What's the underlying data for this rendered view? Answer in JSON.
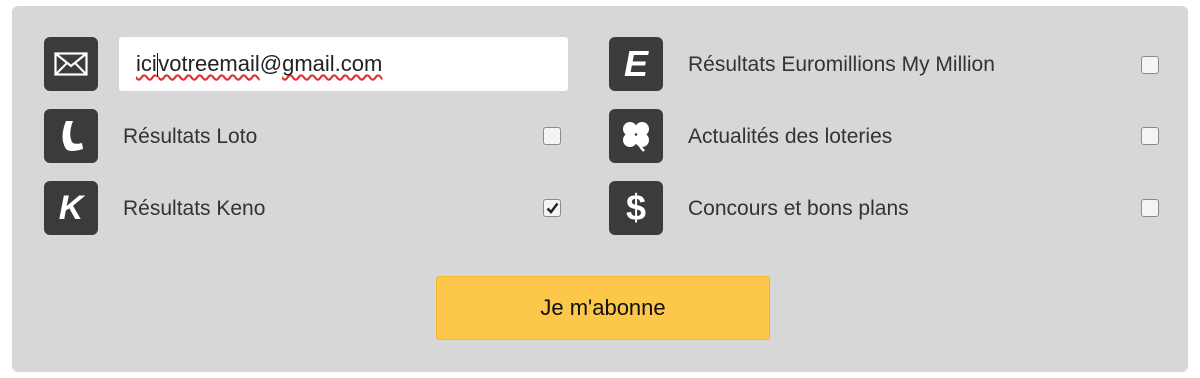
{
  "email": {
    "value_part1": "ici",
    "value_part2": "votreemail",
    "value_part3": "@",
    "value_part4": "gmail.com"
  },
  "options_left": [
    {
      "label": "Résultats Loto",
      "icon": "loto-logo-icon",
      "checked": false
    },
    {
      "label": "Résultats Keno",
      "icon": "keno-logo-icon",
      "checked": true
    }
  ],
  "options_right": [
    {
      "label": "Résultats Euromillions My Million",
      "icon": "euromillions-logo-icon",
      "checked": false
    },
    {
      "label": "Actualités des loteries",
      "icon": "clover-icon",
      "checked": false
    },
    {
      "label": "Concours et bons plans",
      "icon": "dollar-icon",
      "checked": false
    }
  ],
  "icons": {
    "euromillions_letter": "E",
    "keno_letter": "K",
    "dollar_glyph": "$"
  },
  "submit_label": "Je m'abonne",
  "colors": {
    "panel": "#d7d7d7",
    "icon_bg": "#3b3b3b",
    "button": "#fcc74a"
  }
}
